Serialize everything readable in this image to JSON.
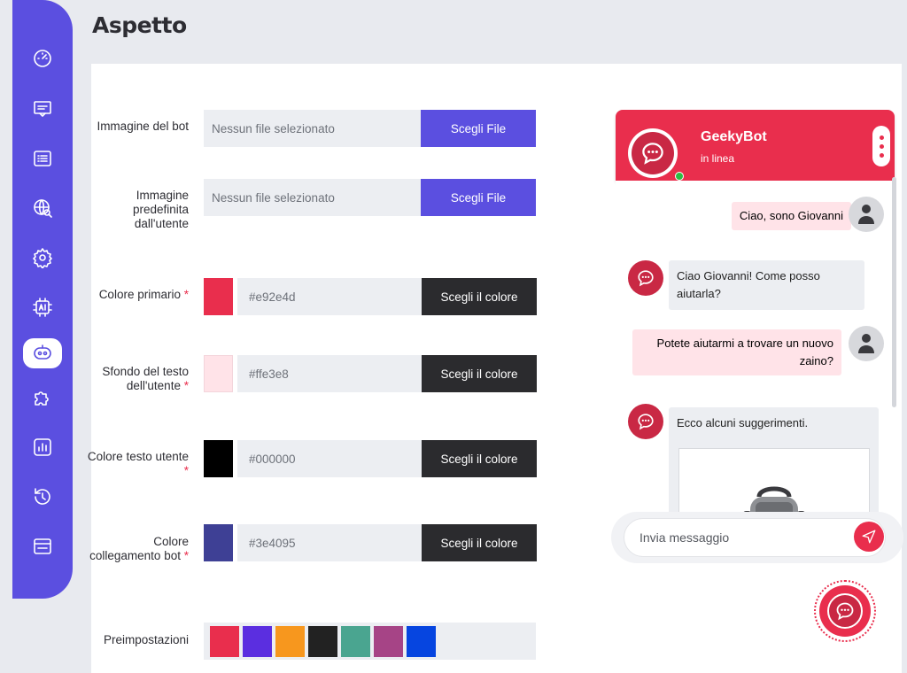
{
  "page": {
    "title": "Aspetto"
  },
  "sidebar": {
    "items": [
      {
        "icon": "dashboard-icon"
      },
      {
        "icon": "chat-icon"
      },
      {
        "icon": "list-icon"
      },
      {
        "icon": "globe-search-icon"
      },
      {
        "icon": "gear-icon"
      },
      {
        "icon": "ai-chip-icon"
      },
      {
        "icon": "bot-icon",
        "active": true
      },
      {
        "icon": "puzzle-icon"
      },
      {
        "icon": "analytics-icon"
      },
      {
        "icon": "history-icon"
      },
      {
        "icon": "window-icon"
      }
    ]
  },
  "form": {
    "bot_image": {
      "label": "Immagine del bot",
      "placeholder": "Nessun file selezionato",
      "button": "Scegli File"
    },
    "user_image": {
      "label": "Immagine predefinita dall'utente",
      "placeholder": "Nessun file selezionato",
      "button": "Scegli File"
    },
    "primary_color": {
      "label": "Colore primario",
      "value": "#e92e4d",
      "button": "Scegli il colore",
      "required": "*"
    },
    "user_text_bg": {
      "label": "Sfondo del testo dell'utente",
      "value": "#ffe3e8",
      "button": "Scegli il colore",
      "required": "*"
    },
    "user_text_color": {
      "label": "Colore testo utente",
      "value": "#000000",
      "button": "Scegli il colore",
      "required": "*"
    },
    "bot_link_color": {
      "label": "Colore collegamento bot",
      "value": "#3e4095",
      "button": "Scegli il colore",
      "required": "*"
    },
    "presets": {
      "label": "Preimpostazioni",
      "colors": [
        "#e92e4d",
        "#5b2ee0",
        "#f7971e",
        "#222222",
        "#4aa590",
        "#a64486",
        "#0645e0"
      ]
    }
  },
  "chat": {
    "bot_name": "GeekyBot",
    "status": "in linea",
    "messages": [
      {
        "from": "user",
        "text": "Ciao, sono Giovanni"
      },
      {
        "from": "bot",
        "text": "Ciao Giovanni! Come posso aiutarla?"
      },
      {
        "from": "user",
        "text": "Potete aiutarmi a trovare un nuovo zaino?"
      },
      {
        "from": "bot",
        "text": "Ecco alcuni suggerimenti."
      }
    ],
    "input_placeholder": "Invia messaggio"
  },
  "colors": {
    "accent": "#5b4fe0",
    "primary": "#e92e4d",
    "user_bubble": "#ffe3e8"
  }
}
